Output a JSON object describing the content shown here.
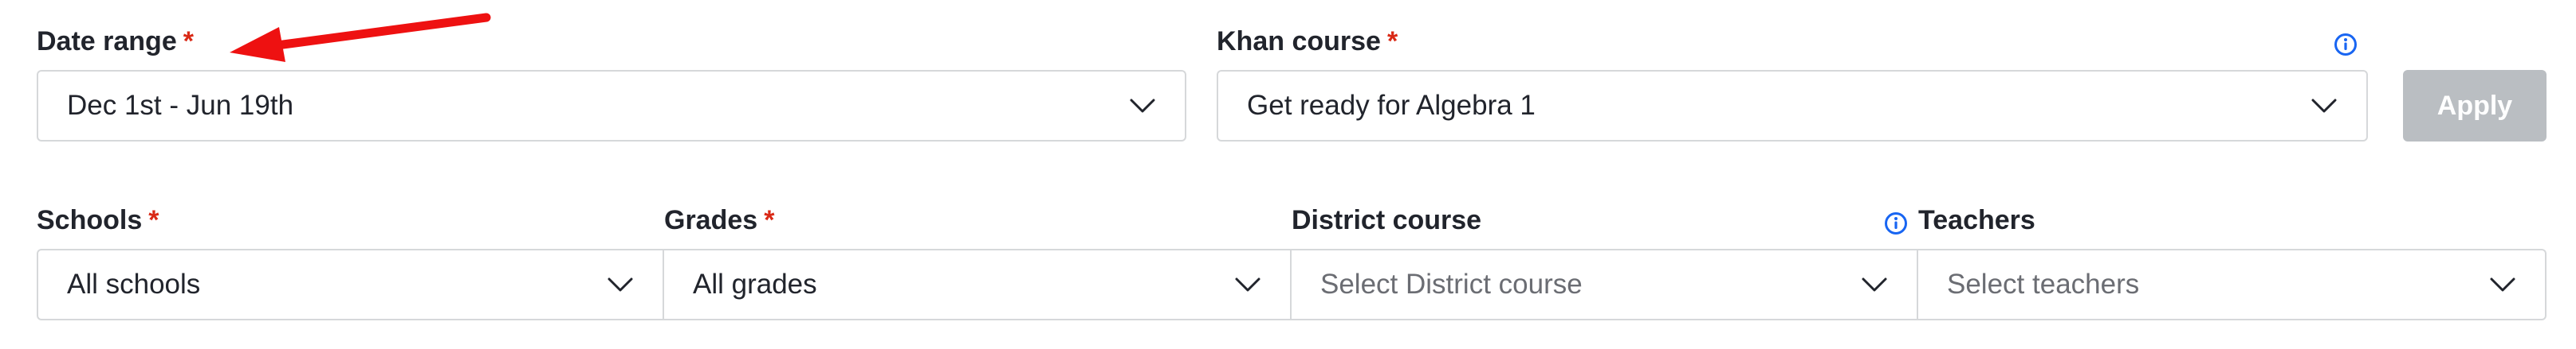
{
  "filters": {
    "date_range": {
      "label": "Date range",
      "required_mark": "*",
      "value": "Dec 1st - Jun 19th"
    },
    "khan_course": {
      "label": "Khan course",
      "required_mark": "*",
      "value": "Get ready for Algebra 1"
    },
    "apply_label": "Apply",
    "schools": {
      "label": "Schools",
      "required_mark": "*",
      "value": "All schools"
    },
    "grades": {
      "label": "Grades",
      "required_mark": "*",
      "value": "All grades"
    },
    "district_course": {
      "label": "District course",
      "placeholder": "Select District course"
    },
    "teachers": {
      "label": "Teachers",
      "placeholder": "Select teachers"
    }
  },
  "icons": {
    "chevron": "chevron-down-icon",
    "info": "info-icon",
    "annotation_arrow": "red-arrow"
  },
  "colors": {
    "required": "#d92916",
    "info": "#1865f2",
    "apply_disabled_bg": "#babec2",
    "annotation_arrow": "#ee1111",
    "border": "#d6d8da"
  }
}
